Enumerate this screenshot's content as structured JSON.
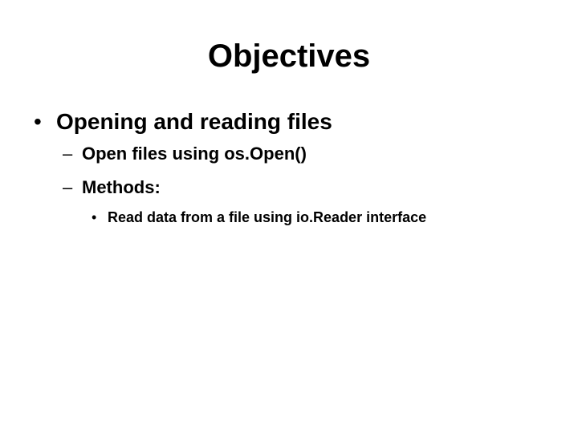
{
  "slide": {
    "title": "Objectives",
    "bullets": [
      {
        "marker": "•",
        "text": "Opening and reading files",
        "sub": [
          {
            "marker": "–",
            "text": "Open files using os.Open()"
          },
          {
            "marker": "–",
            "text": "Methods:",
            "sub": [
              {
                "marker": "•",
                "text": "Read data from a file using io.Reader interface"
              }
            ]
          }
        ]
      }
    ]
  }
}
